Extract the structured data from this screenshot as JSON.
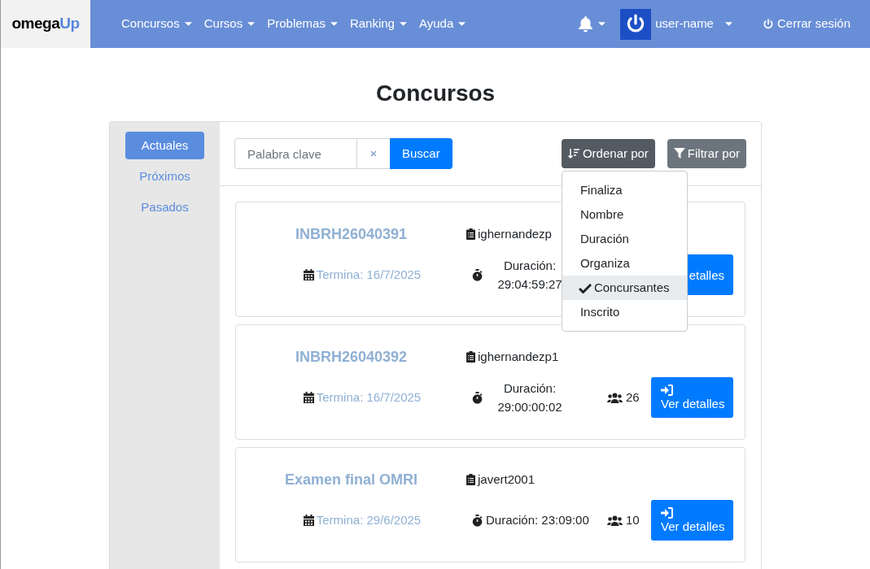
{
  "navbar": {
    "logo": {
      "part_1": "omega",
      "part_2": "Up"
    },
    "menu": [
      "Concursos",
      "Cursos",
      "Problemas",
      "Ranking",
      "Ayuda"
    ],
    "user": "user-name",
    "logout": "Cerrar sesión"
  },
  "title": "Concursos",
  "sidebar": {
    "items": [
      {
        "label": "Actuales",
        "selected": true
      },
      {
        "label": "Próximos",
        "selected": false
      },
      {
        "label": "Pasados",
        "selected": false
      }
    ]
  },
  "search": {
    "placeholder": "Palabra clave",
    "clear": "×",
    "button": "Buscar"
  },
  "sort": {
    "label": "Ordenar por",
    "options": [
      {
        "label": "Finaliza",
        "selected": false
      },
      {
        "label": "Nombre",
        "selected": false
      },
      {
        "label": "Duración",
        "selected": false
      },
      {
        "label": "Organiza",
        "selected": false
      },
      {
        "label": "Concursantes",
        "selected": true
      },
      {
        "label": "Inscrito",
        "selected": false
      }
    ]
  },
  "filter": {
    "label": "Filtrar por"
  },
  "contests": [
    {
      "title": "INBRH26040391",
      "owner": "ighernandezp",
      "ends": "Termina: 16/7/2025",
      "duration": [
        "Duración:",
        "29:04:59:27"
      ],
      "button": {
        "label": "etalles",
        "icon": false
      }
    },
    {
      "title": "INBRH26040392",
      "owner": "ighernandezp1",
      "ends": "Termina: 16/7/2025",
      "duration": [
        "Duración:",
        "29:00:00:02"
      ],
      "participants": "26",
      "button": {
        "label": "Ver detalles",
        "icon": true
      }
    },
    {
      "title": "Examen final OMRI",
      "owner": "javert2001",
      "ends": "Termina: 29/6/2025",
      "duration": [
        "Duración: 23:09:00"
      ],
      "participants": "10",
      "button": {
        "label": "Ver detalles",
        "icon": true
      }
    }
  ]
}
